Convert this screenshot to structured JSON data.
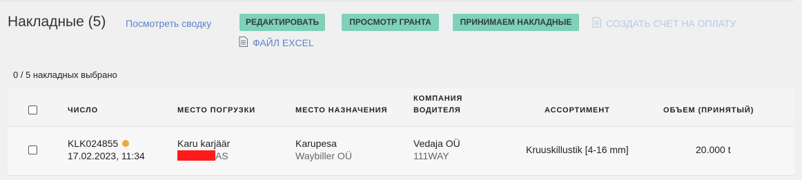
{
  "header": {
    "title": "Накладные (5)",
    "summary_link": "Посмотреть сводку",
    "buttons": {
      "edit": "РЕДАКТИРОВАТЬ",
      "grant_view": "ПРОСМОТР ГРАНТА",
      "accept": "ПРИНИМАЕМ НАКЛАДНЫЕ"
    },
    "create_invoice": "СОЗДАТЬ СЧЕТ НА ОПЛАТУ",
    "excel_file": "ФАЙЛ EXCEL"
  },
  "selection_status": "0 / 5 накладных выбрано",
  "table": {
    "columns": {
      "number": "ЧИСЛО",
      "loading_place": "МЕСТО ПОГРУЗКИ",
      "destination": "МЕСТО НАЗНАЧЕНИЯ",
      "driver_company_line1": "КОМПАНИЯ",
      "driver_company_line2": "ВОДИТЕЛЯ",
      "assortment": "АССОРТИМЕНТ",
      "volume": "ОБЪЕМ (ПРИНЯТЫЙ)"
    },
    "rows": [
      {
        "number": "KLK024855",
        "date": "17.02.2023, 11:34",
        "status_color": "#f3a53b",
        "loading_place": "Karu karjäär",
        "loading_company_visible": "AS",
        "destination": "Karupesa",
        "destination_sub": "Waybiller OÜ",
        "driver_company": "Vedaja OÜ",
        "driver_company_sub": "111WAY",
        "assortment": "Kruuskillustik [4-16 mm]",
        "volume": "20.000 t"
      }
    ]
  },
  "colors": {
    "background": "#f0f0f0",
    "button_bg": "#7fd1b9",
    "link": "#5b82c9",
    "disabled_link": "#b8c8e4",
    "redaction": "#ff1b1b"
  },
  "icons": {
    "invoice": "document-icon",
    "excel": "document-icon"
  }
}
